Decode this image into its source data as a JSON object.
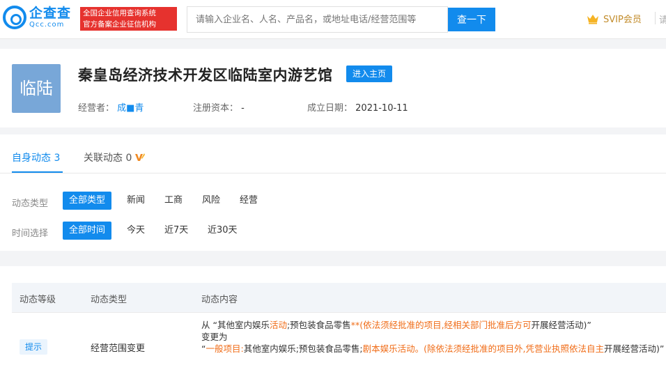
{
  "header": {
    "logo_cn": "企查查",
    "logo_en": "Qcc.com",
    "badge_line1": "全国企业信用查询系统",
    "badge_line2": "官方备案企业征信机构",
    "search_placeholder": "请输入企业名、人名、产品名，或地址电话/经营范围等",
    "search_button": "查一下",
    "svip_label": "SVIP会员",
    "cut_text": "请"
  },
  "company": {
    "logo_text": "临陆",
    "name": "秦皇岛经济技术开发区临陆室内游艺馆",
    "enter_button": "进入主页",
    "operator_label": "经营者：",
    "operator_value": "成■青",
    "capital_label": "注册资本：",
    "capital_value": "-",
    "founded_label": "成立日期：",
    "founded_value": "2021-10-11"
  },
  "tabs": [
    {
      "label": "自身动态 3",
      "active": true
    },
    {
      "label": "关联动态 0",
      "active": false
    }
  ],
  "filters": {
    "type_label": "动态类型",
    "type_options": [
      "全部类型",
      "新闻",
      "工商",
      "风险",
      "经营"
    ],
    "time_label": "时间选择",
    "time_options": [
      "全部时间",
      "今天",
      "近7天",
      "近30天"
    ]
  },
  "table": {
    "headers": [
      "动态等级",
      "动态类型",
      "动态内容"
    ],
    "rows": [
      {
        "level": "提示",
        "type": "经营范围变更",
        "content": {
          "from_prefix": "从 “其他室内娱乐",
          "from_hl1": "活动",
          "from_mid": ";预包装食品零售",
          "from_hl2": "**(依法须经批准的项目,经相关部门批准后方可",
          "from_suffix": "开展经营活动)”",
          "change_to": "变更为",
          "to_prefix": "“",
          "to_hl1": "一般项目:",
          "to_mid": "其他室内娱乐;预包装食品零售;",
          "to_hl2": "剧本娱乐活动。(除依法须经批准的项目外,凭营业执照依法自主",
          "to_suffix": "开展经营活动)”"
        }
      }
    ]
  },
  "colors": {
    "primary": "#128bed",
    "highlight": "#f06c17",
    "badge_red": "#e6322e",
    "svip_gold": "#c28c2b"
  }
}
